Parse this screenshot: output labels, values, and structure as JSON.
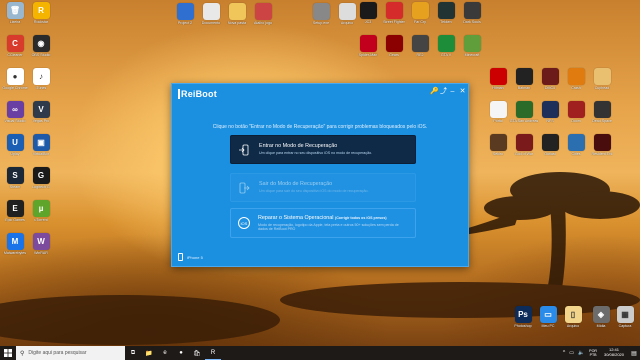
{
  "desktop": {
    "left_icons": [
      {
        "label": "Lixeira",
        "color": "#9ab7d0",
        "glyph": "🗑"
      },
      {
        "label": "CCleaner",
        "color": "#d83b2b",
        "glyph": "C"
      },
      {
        "label": "Google Chrome",
        "color": "#ffffff",
        "glyph": "●"
      },
      {
        "label": "Visual Studio",
        "color": "#6a3fa3",
        "glyph": "∞"
      },
      {
        "label": "Uplay",
        "color": "#1b5fb5",
        "glyph": "U"
      },
      {
        "label": "Steam",
        "color": "#1b2838",
        "glyph": "S"
      },
      {
        "label": "Epic Games",
        "color": "#202020",
        "glyph": "E"
      },
      {
        "label": "Malwarebytes",
        "color": "#1a73e8",
        "glyph": "M"
      },
      {
        "label": "Rockstar",
        "color": "#f5b400",
        "glyph": "R"
      },
      {
        "label": "OBS Studio",
        "color": "#2b2b2b",
        "glyph": "◉"
      },
      {
        "label": "iTunes",
        "color": "#ffffff",
        "glyph": "♪"
      },
      {
        "label": "Vegas Pro",
        "color": "#2f3b4a",
        "glyph": "V"
      },
      {
        "label": "VirtualBox",
        "color": "#1f5aa8",
        "glyph": "▣"
      },
      {
        "label": "Logitech G",
        "color": "#1a1a1a",
        "glyph": "G"
      },
      {
        "label": "uTorrent",
        "color": "#5fa52c",
        "glyph": "µ"
      },
      {
        "label": "WinRAR",
        "color": "#7d4b9e",
        "glyph": "W"
      }
    ],
    "top_icons": [
      {
        "label": "Project 2",
        "color": "#2f6fd0"
      },
      {
        "label": "Documento",
        "color": "#e8e8e8"
      },
      {
        "label": "Nova pasta",
        "color": "#f0c55a"
      },
      {
        "label": "Atalho jogo",
        "color": "#c44"
      },
      {
        "label": "Setup.exe",
        "color": "#888"
      },
      {
        "label": "Arquivo",
        "color": "#ddd"
      }
    ],
    "right_icons": [
      {
        "label": "JC3",
        "color": "#1a1a1a"
      },
      {
        "label": "Street Fighter",
        "color": "#d62b2b"
      },
      {
        "label": "Far Cry",
        "color": "#e6a11f"
      },
      {
        "label": "Tekken",
        "color": "#233"
      },
      {
        "label": "Dark Souls",
        "color": "#3a3a3a"
      },
      {
        "label": "Spider-Man",
        "color": "#c2001d"
      },
      {
        "label": "Gears",
        "color": "#8b0000"
      },
      {
        "label": "RE2",
        "color": "#444"
      },
      {
        "label": "GTA V",
        "color": "#1d8d3a"
      },
      {
        "label": "Minecraft",
        "color": "#5f9e3a"
      },
      {
        "label": "Hitman",
        "color": "#cc0000"
      },
      {
        "label": "Batman",
        "color": "#222"
      },
      {
        "label": "DMC5",
        "color": "#6c1a1a"
      },
      {
        "label": "Crash",
        "color": "#e07b10"
      },
      {
        "label": "Cuphead",
        "color": "#e8c070"
      },
      {
        "label": "Portal",
        "color": "#f5f5f5"
      },
      {
        "label": "GTA San Andreas",
        "color": "#2a6b2a"
      },
      {
        "label": "NFS",
        "color": "#1e2f5a"
      },
      {
        "label": "Doom",
        "color": "#a02020"
      },
      {
        "label": "Dead Space",
        "color": "#333"
      },
      {
        "label": "Sekiro",
        "color": "#5a3a20"
      },
      {
        "label": "God of War",
        "color": "#7a1a1a"
      },
      {
        "label": "Outlast",
        "color": "#222"
      },
      {
        "label": "Cities",
        "color": "#2b6fb0"
      },
      {
        "label": "Resident Evil",
        "color": "#4a0d0d"
      }
    ],
    "misc_icons": [
      {
        "label": "Photoshop",
        "color": "#0d2c5a",
        "glyph": "Ps"
      },
      {
        "label": "Meu PC",
        "color": "#2a8be8",
        "glyph": "▭"
      },
      {
        "label": "Arquivo",
        "color": "#f2d58a",
        "glyph": "▯"
      },
      {
        "label": "Mídia",
        "color": "#6c6c6c",
        "glyph": "◈"
      },
      {
        "label": "Captura",
        "color": "#cccccc",
        "glyph": "▦"
      }
    ]
  },
  "window": {
    "logo_prefix": "R",
    "logo_rest": "eiBoot",
    "subtitle": "Clique no botão \"Entrar no Modo de Recuperação\" para corrigir problemas bloqueados pelo iOS.",
    "options": [
      {
        "title": "Entrar no Modo de Recuperação",
        "desc": "Um clique para entrar no seu dispositivo iOS no modo de recuperação."
      },
      {
        "title": "Sair do Modo de Recuperação",
        "desc": "Um clique para sair do seu dispositivo iOS do modo de recuperação."
      },
      {
        "title": "Reparar o Sistema Operacional",
        "title_suffix": "(Corrigir todos os iOS presos)",
        "desc": "Modo de recuperação, logotipo da Apple, tela preta e outros 50+ soluções sem perda de dados de ReiBoot PRO",
        "icon_text": "iOS"
      }
    ],
    "device": "iPhone 5"
  },
  "taskbar": {
    "search_placeholder": "Digite aqui para pesquisar",
    "apps": [
      {
        "name": "task-view",
        "glyph": "⧉"
      },
      {
        "name": "file-explorer",
        "glyph": "📁"
      },
      {
        "name": "edge",
        "glyph": "e"
      },
      {
        "name": "chrome",
        "glyph": "●"
      },
      {
        "name": "store",
        "glyph": "🛍"
      },
      {
        "name": "reiboot",
        "glyph": "R"
      }
    ],
    "lang_top": "POR",
    "lang_bottom": "PTB",
    "time": "12:41",
    "date": "30/08/2020"
  }
}
